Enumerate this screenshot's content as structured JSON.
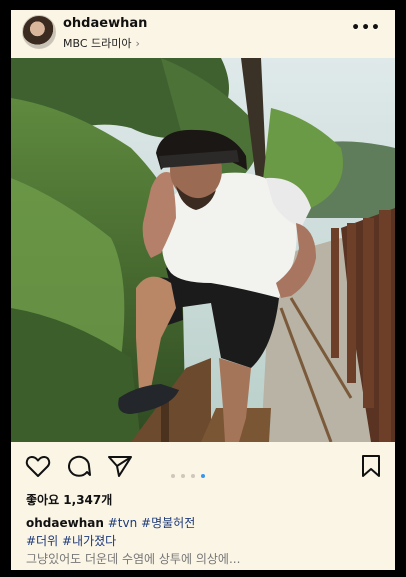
{
  "post": {
    "username": "ohdaewhan",
    "location": "MBC 드라미아",
    "more_label": "•••",
    "likes_text": "좋아요 1,347개",
    "caption": {
      "username": "ohdaewhan",
      "tags_line1": [
        "#tvn",
        "#명불허전"
      ],
      "tags_line2": [
        "#더위",
        "#내가졌다"
      ],
      "text": "그냥있어도 더운데 수염에 상투에 의상에..."
    },
    "carousel": {
      "count": 4,
      "active_index": 3
    }
  },
  "icons": [
    "heart-icon",
    "comment-icon",
    "share-icon",
    "bookmark-icon",
    "chevron-right-icon"
  ],
  "colors": {
    "background": "#fbf5e6",
    "accent": "#3797f0",
    "hashtag": "#1d3a7a"
  }
}
